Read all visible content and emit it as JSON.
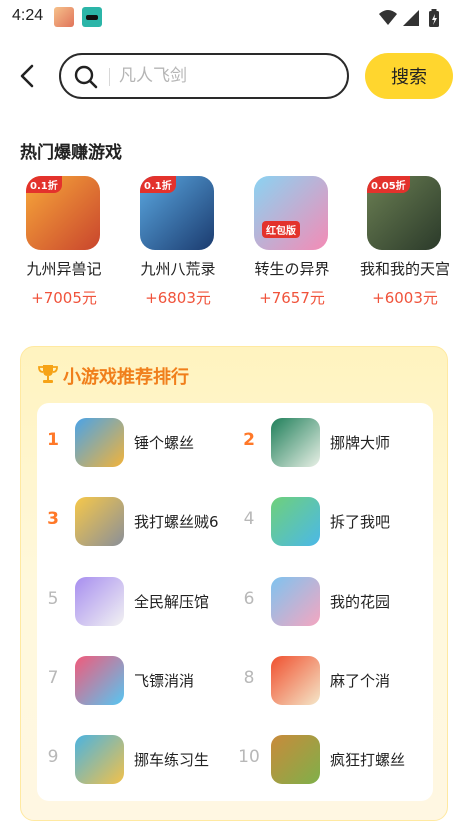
{
  "status": {
    "time": "4:24"
  },
  "search": {
    "placeholder": "凡人飞剑",
    "value": "",
    "button_label": "搜索"
  },
  "hot_games": {
    "title": "热门爆赚游戏",
    "items": [
      {
        "name": "九州异兽记",
        "reward": "+7005元",
        "badge": "0.1折",
        "colors": [
          "#f7a83a",
          "#c9452d"
        ]
      },
      {
        "name": "九州八荒录",
        "reward": "+6803元",
        "badge": "0.1折",
        "colors": [
          "#5aa7e0",
          "#1b3b6f"
        ]
      },
      {
        "name": "转生の异界",
        "reward": "+7657元",
        "badge": "红包版",
        "colors": [
          "#8ad3f2",
          "#f48bb5"
        ]
      },
      {
        "name": "我和我的天宫",
        "reward": "+6003元",
        "badge": "0.05折",
        "colors": [
          "#6b7f53",
          "#2b3a2a"
        ]
      }
    ]
  },
  "ranking": {
    "title": "小游戏推荐排行",
    "items": [
      {
        "rank": "1",
        "name": "锤个螺丝",
        "colors": [
          "#4aa3e8",
          "#f2b33a"
        ]
      },
      {
        "rank": "2",
        "name": "挪牌大师",
        "colors": [
          "#1f7f5a",
          "#e9f0e6"
        ]
      },
      {
        "rank": "3",
        "name": "我打螺丝贼6",
        "colors": [
          "#f6c84a",
          "#8a8f98"
        ]
      },
      {
        "rank": "4",
        "name": "拆了我吧",
        "colors": [
          "#6fd07a",
          "#4bb8e8"
        ]
      },
      {
        "rank": "5",
        "name": "全民解压馆",
        "colors": [
          "#a78ef0",
          "#f2f2f2"
        ]
      },
      {
        "rank": "6",
        "name": "我的花园",
        "colors": [
          "#7ec3ef",
          "#f5a6c0"
        ]
      },
      {
        "rank": "7",
        "name": "飞镖消消",
        "colors": [
          "#f25a7a",
          "#56c6f2"
        ]
      },
      {
        "rank": "8",
        "name": "麻了个消",
        "colors": [
          "#f0502f",
          "#f4e7c9"
        ]
      },
      {
        "rank": "9",
        "name": "挪车练习生",
        "colors": [
          "#4bb3e0",
          "#f2c14a"
        ]
      },
      {
        "rank": "10",
        "name": "疯狂打螺丝",
        "colors": [
          "#c98a3b",
          "#7fb04a"
        ]
      }
    ]
  },
  "colors": {
    "accent_yellow": "#ffd62e",
    "reward_red": "#f0533b",
    "rank_orange": "#ff7828",
    "rank_title": "#f07f1b"
  }
}
